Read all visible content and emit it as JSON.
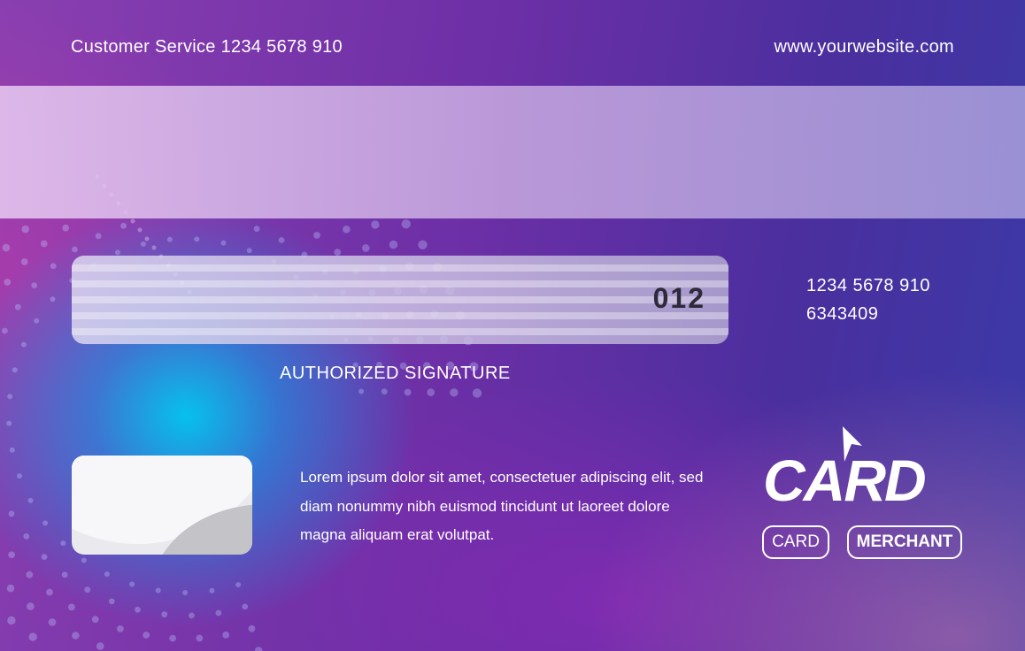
{
  "header": {
    "customer_service": "Customer Service 1234 5678 910",
    "website": "www.yourwebsite.com"
  },
  "signature_panel": {
    "cvv": "012",
    "label": "AUTHORIZED SIGNATURE"
  },
  "account": {
    "line1": "1234 5678 910",
    "line2": "6343409"
  },
  "body_text": "Lorem ipsum dolor sit amet, consectetuer adipiscing elit, sed diam nonummy nibh euismod tincidunt ut laoreet dolore magna aliquam erat volutpat.",
  "logo": {
    "wordmark": "CARD",
    "badges": [
      "CARD",
      "MERCHANT"
    ]
  },
  "colors": {
    "primary_purple": "#6c2fa6",
    "accent_cyan": "#00c8f0",
    "text": "#ffffff",
    "cvv_text": "#2e2a3a"
  }
}
